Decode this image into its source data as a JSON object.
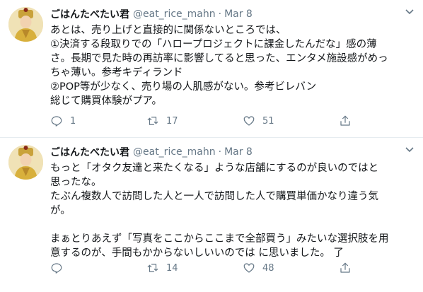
{
  "tweets": [
    {
      "author_name": "ごはんたべたい君",
      "handle": "@eat_rice_mahn",
      "separator": "·",
      "date": "Mar 8",
      "lines": [
        "あとは、売り上げと直接的に関係ないところでは、",
        "①決済する段取りでの「ハロープロジェクトに課金したんだな」感の薄",
        "さ。長期で見た時の再訪率に影響してると思った、エンタメ施設感がめっ",
        "ちゃ薄い。参考キディランド",
        "②POP等が少なく、売り場の人肌感がない。参考ビレバン",
        "総じて購買体験がプア。"
      ],
      "replies": "1",
      "retweets": "17",
      "likes": "51"
    },
    {
      "author_name": "ごはんたべたい君",
      "handle": "@eat_rice_mahn",
      "separator": "·",
      "date": "Mar 8",
      "lines": [
        "もっと「オタク友達と来たくなる」ような店舗にするのが良いのではと",
        "思ったな。",
        "たぶん複数人で訪問した人と一人で訪問した人で購買単価かなり違う気",
        "が。",
        "",
        "まぁとりあえず「写真をここからここまで全部買う」みたいな選択肢を用",
        "意するのが、手間もかからないしいいのでは に思いました。 了"
      ],
      "replies": "",
      "retweets": "14",
      "likes": "48"
    }
  ],
  "colors": {
    "text": "#14171a",
    "muted": "#657786",
    "divider": "#e6ecf0"
  },
  "icons": [
    "reply-icon",
    "retweet-icon",
    "like-icon",
    "share-icon",
    "caret-down-icon"
  ]
}
